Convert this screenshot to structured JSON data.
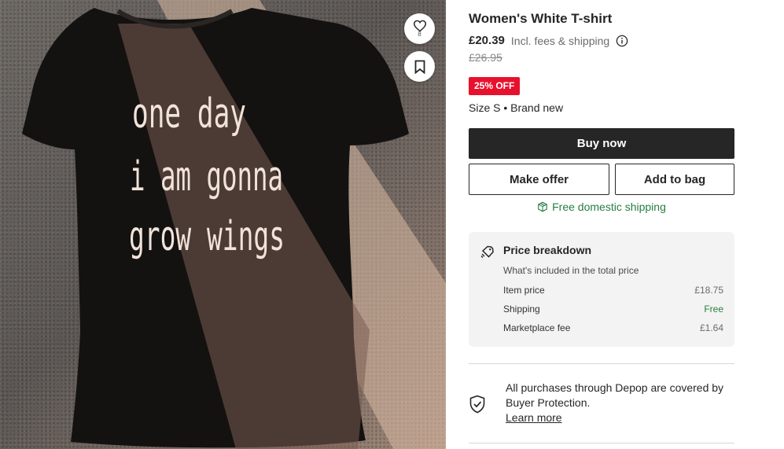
{
  "product": {
    "title": "Women's White T-shirt",
    "price": "£20.39",
    "price_note": "Incl. fees & shipping",
    "old_price": "£26.95",
    "discount_badge": "25% OFF",
    "size_condition": "Size S • Brand new",
    "likes_count": "8",
    "shirt_print_lines": [
      "one day",
      "i am gonna",
      "grow wings"
    ]
  },
  "actions": {
    "buy_now": "Buy now",
    "make_offer": "Make offer",
    "add_to_bag": "Add to bag"
  },
  "shipping": {
    "label": "Free domestic shipping"
  },
  "breakdown": {
    "title": "Price breakdown",
    "subtitle": "What's included in the total price",
    "rows": [
      {
        "label": "Item price",
        "value": "£18.75"
      },
      {
        "label": "Shipping",
        "value": "Free"
      },
      {
        "label": "Marketplace fee",
        "value": "£1.64"
      }
    ]
  },
  "protection": {
    "text": "All purchases through Depop are covered by Buyer Protection.",
    "link": "Learn more"
  },
  "icons": {
    "favorite": "heart-icon",
    "save": "bookmark-icon",
    "info": "info-icon",
    "shipping": "box-icon",
    "breakdown": "price-tag-icon",
    "protection": "shield-check-icon"
  },
  "colors": {
    "primary": "#262626",
    "discount": "#e8112d",
    "shipping_green": "#277d3f",
    "breakdown_bg": "#f3f3f3"
  }
}
